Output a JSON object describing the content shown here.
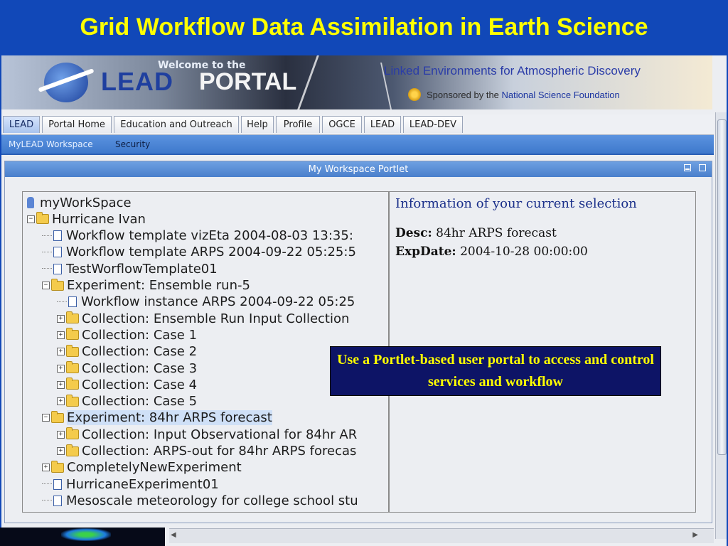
{
  "slide": {
    "title": "Grid Workflow Data Assimilation in Earth Science"
  },
  "banner": {
    "welcome": "Welcome to the",
    "logo_text": "LEAD",
    "portal_text": "PORTAL",
    "tagline": "Linked Environments for Atmospheric Discovery",
    "sponsor_prefix": "Sponsored by the",
    "sponsor_org": "National Science Foundation"
  },
  "tabs": [
    {
      "label": "LEAD",
      "active": true
    },
    {
      "label": "Portal Home"
    },
    {
      "label": "Education and Outreach"
    },
    {
      "label": "Help"
    },
    {
      "label": "Profile"
    },
    {
      "label": "OGCE"
    },
    {
      "label": "LEAD"
    },
    {
      "label": "LEAD-DEV"
    }
  ],
  "subnav": {
    "workspace": "MyLEAD Workspace",
    "security": "Security"
  },
  "portlet": {
    "title": "My Workspace Portlet",
    "tree": [
      {
        "label": "myWorkSpace",
        "level": 0,
        "icon": "root-icon"
      },
      {
        "label": "Hurricane Ivan",
        "level": 0,
        "icon": "folder-icon",
        "expander": "−"
      },
      {
        "label": "Workflow template vizEta 2004-08-03 13:35:",
        "level": 1,
        "icon": "document-icon"
      },
      {
        "label": "Workflow template ARPS 2004-09-22 05:25:5",
        "level": 1,
        "icon": "document-icon"
      },
      {
        "label": "TestWorflowTemplate01",
        "level": 1,
        "icon": "document-icon"
      },
      {
        "label": "Experiment: Ensemble run-5",
        "level": 1,
        "icon": "folder-icon",
        "expander": "−"
      },
      {
        "label": "Workflow instance ARPS 2004-09-22 05:25",
        "level": 2,
        "icon": "document-icon"
      },
      {
        "label": "Collection: Ensemble Run Input Collection",
        "level": 2,
        "icon": "folder-icon",
        "expander": "+"
      },
      {
        "label": "Collection: Case 1",
        "level": 2,
        "icon": "folder-icon",
        "expander": "+"
      },
      {
        "label": "Collection: Case 2",
        "level": 2,
        "icon": "folder-icon",
        "expander": "+"
      },
      {
        "label": "Collection: Case 3",
        "level": 2,
        "icon": "folder-icon",
        "expander": "+"
      },
      {
        "label": "Collection: Case 4",
        "level": 2,
        "icon": "folder-icon",
        "expander": "+"
      },
      {
        "label": "Collection: Case 5",
        "level": 2,
        "icon": "folder-icon",
        "expander": "+"
      },
      {
        "label": "Experiment: 84hr ARPS forecast",
        "level": 1,
        "icon": "folder-icon",
        "expander": "−",
        "selected": true
      },
      {
        "label": "Collection: Input Observational for 84hr AR",
        "level": 2,
        "icon": "folder-icon",
        "expander": "+"
      },
      {
        "label": "Collection: ARPS-out for 84hr ARPS forecas",
        "level": 2,
        "icon": "folder-icon",
        "expander": "+"
      },
      {
        "label": "CompletelyNewExperiment",
        "level": 1,
        "icon": "folder-icon",
        "expander": "+"
      },
      {
        "label": "HurricaneExperiment01",
        "level": 1,
        "icon": "document-icon"
      },
      {
        "label": "Mesoscale meteorology for college school stu",
        "level": 1,
        "icon": "document-icon"
      }
    ],
    "info": {
      "title": "Information of your current selection",
      "desc_label": "Desc:",
      "desc_value": "84hr ARPS forecast",
      "expdate_label": "ExpDate:",
      "expdate_value": "2004-10-28 00:00:00"
    }
  },
  "callout": {
    "text": "Use a Portlet-based user portal to access and control services and workflow"
  },
  "colors": {
    "slide_bg": "#1148b8",
    "title": "#ffff00",
    "callout_bg": "#0d1466",
    "selection": "#cfe0f7"
  }
}
